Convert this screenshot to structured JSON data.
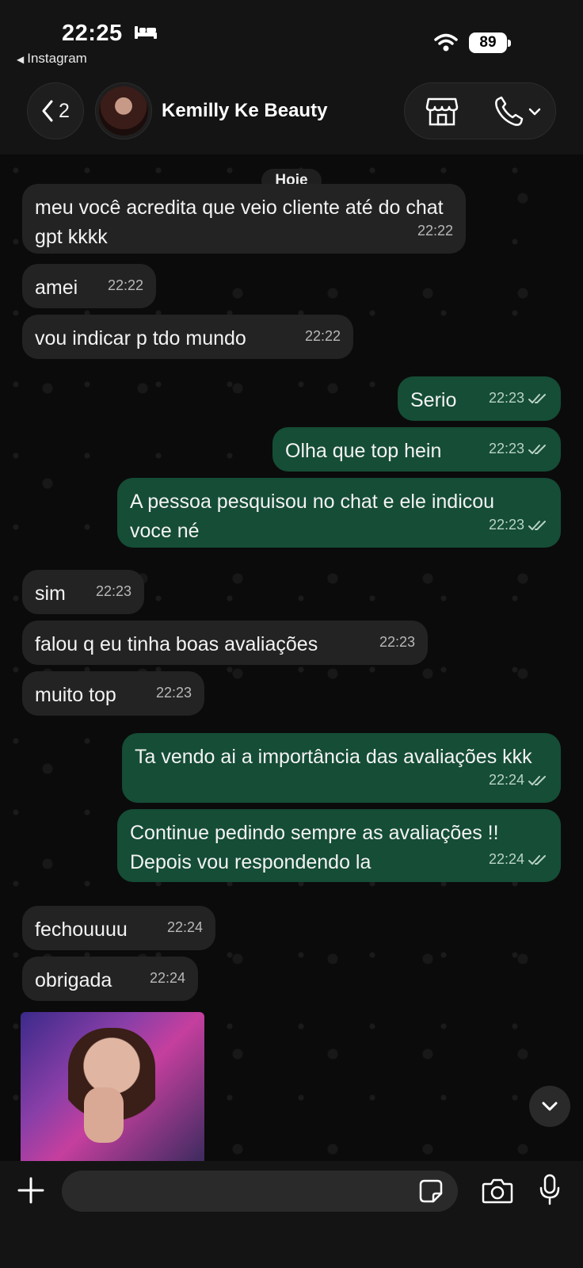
{
  "status_bar": {
    "time": "22:25",
    "back_app": "Instagram",
    "battery": "89"
  },
  "header": {
    "back_count": "2",
    "contact_name": "Kemilly Ke Beauty"
  },
  "chat": {
    "date_label": "Hoje",
    "messages": [
      {
        "dir": "in",
        "text": "meu você acredita que veio cliente até do chat gpt kkkk",
        "time": "22:22"
      },
      {
        "dir": "in",
        "text": "amei",
        "time": "22:22"
      },
      {
        "dir": "in",
        "text": "vou indicar p tdo mundo",
        "time": "22:22"
      },
      {
        "dir": "out",
        "text": "Serio",
        "time": "22:23"
      },
      {
        "dir": "out",
        "text": "Olha que top hein",
        "time": "22:23"
      },
      {
        "dir": "out",
        "text": "A pessoa pesquisou no chat e ele indicou voce né",
        "time": "22:23"
      },
      {
        "dir": "in",
        "text": "sim",
        "time": "22:23"
      },
      {
        "dir": "in",
        "text": "falou q eu tinha boas avaliações",
        "time": "22:23"
      },
      {
        "dir": "in",
        "text": "muito top",
        "time": "22:23"
      },
      {
        "dir": "out",
        "text": "Ta vendo ai a importância das avaliações kkk",
        "time": "22:24"
      },
      {
        "dir": "out",
        "text": "Continue pedindo sempre as avaliações !! Depois vou respondendo la",
        "time": "22:24"
      },
      {
        "dir": "in",
        "text": "fechouuuu",
        "time": "22:24"
      },
      {
        "dir": "in",
        "text": "obrigada",
        "time": "22:24"
      }
    ]
  },
  "composer": {
    "placeholder": ""
  },
  "colors": {
    "incoming_bubble": "#232323",
    "outgoing_bubble": "#154d36",
    "background": "#0b0b0b"
  }
}
